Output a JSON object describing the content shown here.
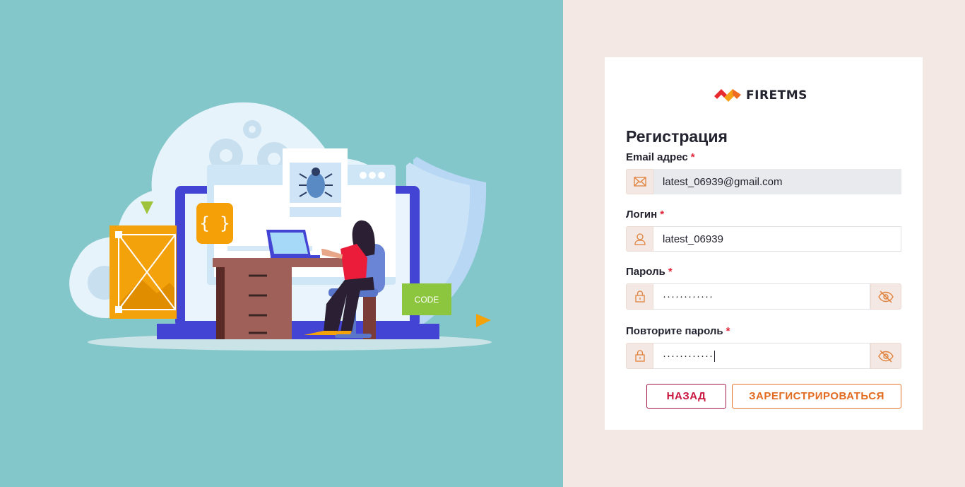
{
  "logo": {
    "text": "FIRETMS",
    "icon": "firetms-logo-icon"
  },
  "form": {
    "title": "Регистрация",
    "required_mark": "*",
    "email": {
      "label": "Email адрес",
      "value": "latest_06939@gmail.com",
      "icon": "envelope-icon",
      "disabled": true
    },
    "login": {
      "label": "Логин",
      "value": "latest_06939",
      "icon": "user-icon"
    },
    "password": {
      "label": "Пароль",
      "value": "············",
      "icon": "lock-icon",
      "toggle_icon": "eye-off-icon"
    },
    "password_repeat": {
      "label": "Повторите пароль",
      "value": "············",
      "icon": "lock-icon",
      "toggle_icon": "eye-off-icon"
    }
  },
  "buttons": {
    "back": "НАЗАД",
    "register": "ЗАРЕГИСТРИРОВАТЬСЯ"
  },
  "illustration": {
    "badge_text": "CODE",
    "braces_text": "{ }"
  },
  "colors": {
    "left_bg": "#84c7cb",
    "right_bg": "#f3e8e3",
    "accent": "#e26a1f",
    "back": "#c8163f"
  }
}
